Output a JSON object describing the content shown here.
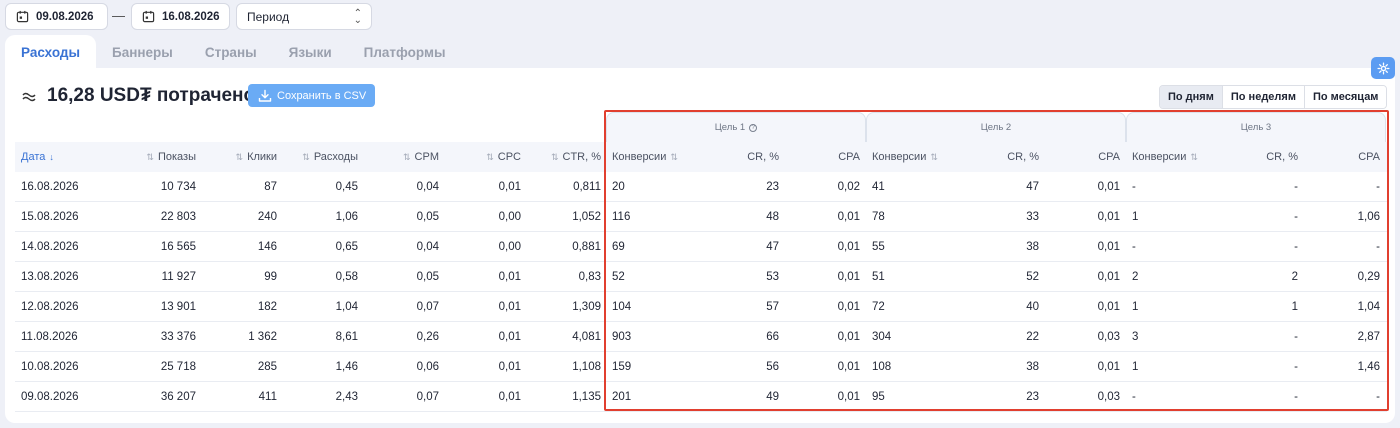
{
  "date_range": {
    "from": "09.08.2026",
    "separator": "—",
    "to": "16.08.2026"
  },
  "period_select": {
    "value": "Период"
  },
  "tabs": [
    {
      "label": "Расходы",
      "active": true
    },
    {
      "label": "Баннеры"
    },
    {
      "label": "Страны"
    },
    {
      "label": "Языки"
    },
    {
      "label": "Платформы"
    }
  ],
  "summary": {
    "spent": "16,28 USD₮ потрачено",
    "csv_button": "Сохранить в CSV"
  },
  "granularity": [
    "По дням",
    "По неделям",
    "По месяцам"
  ],
  "goals": [
    {
      "label": "Цель 1"
    },
    {
      "label": "Цель 2"
    },
    {
      "label": "Цель 3"
    }
  ],
  "columns": [
    "Дата",
    "Показы",
    "Клики",
    "Расходы",
    "CPM",
    "CPC",
    "CTR, %",
    "Конверсии",
    "CR, %",
    "CPA",
    "Конверсии",
    "CR, %",
    "CPA",
    "Конверсии",
    "CR, %",
    "CPA"
  ],
  "rows": [
    [
      "16.08.2026",
      "10 734",
      "87",
      "0,45",
      "0,04",
      "0,01",
      "0,811",
      "20",
      "23",
      "0,02",
      "41",
      "47",
      "0,01",
      "-",
      "-",
      "-"
    ],
    [
      "15.08.2026",
      "22 803",
      "240",
      "1,06",
      "0,05",
      "0,00",
      "1,052",
      "116",
      "48",
      "0,01",
      "78",
      "33",
      "0,01",
      "1",
      "-",
      "1,06"
    ],
    [
      "14.08.2026",
      "16 565",
      "146",
      "0,65",
      "0,04",
      "0,00",
      "0,881",
      "69",
      "47",
      "0,01",
      "55",
      "38",
      "0,01",
      "-",
      "-",
      "-"
    ],
    [
      "13.08.2026",
      "11 927",
      "99",
      "0,58",
      "0,05",
      "0,01",
      "0,83",
      "52",
      "53",
      "0,01",
      "51",
      "52",
      "0,01",
      "2",
      "2",
      "0,29"
    ],
    [
      "12.08.2026",
      "13 901",
      "182",
      "1,04",
      "0,07",
      "0,01",
      "1,309",
      "104",
      "57",
      "0,01",
      "72",
      "40",
      "0,01",
      "1",
      "1",
      "1,04"
    ],
    [
      "11.08.2026",
      "33 376",
      "1 362",
      "8,61",
      "0,26",
      "0,01",
      "4,081",
      "903",
      "66",
      "0,01",
      "304",
      "22",
      "0,03",
      "3",
      "-",
      "2,87"
    ],
    [
      "10.08.2026",
      "25 718",
      "285",
      "1,46",
      "0,06",
      "0,01",
      "1,108",
      "159",
      "56",
      "0,01",
      "108",
      "38",
      "0,01",
      "1",
      "-",
      "1,46"
    ],
    [
      "09.08.2026",
      "36 207",
      "411",
      "2,43",
      "0,07",
      "0,01",
      "1,135",
      "201",
      "49",
      "0,01",
      "95",
      "23",
      "0,03",
      "-",
      "-",
      "-"
    ]
  ]
}
